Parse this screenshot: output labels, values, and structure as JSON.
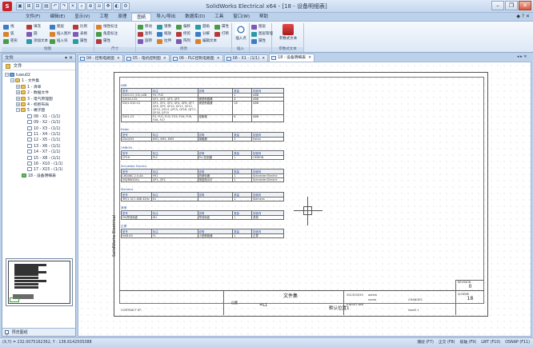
{
  "app": {
    "logo_letter": "S",
    "title": "SolidWorks Electrical x64 - [18 - 设备明细表]",
    "qat": [
      "▣",
      "⊞",
      "⊟",
      "▤",
      "↶",
      "↷",
      "✕",
      "⌕",
      "⊕",
      "⊖",
      "✥",
      "◐",
      "⚙"
    ]
  },
  "window_controls": {
    "minimize": "–",
    "maximize": "❐",
    "close": "✕"
  },
  "ribbon_tabs": [
    "文件(F)",
    "编辑(E)",
    "显示(V)",
    "工程",
    "原理",
    "图纸",
    "导入/导出",
    "数据库(D)",
    "工具",
    "窗口(W)",
    "帮助"
  ],
  "active_ribbon_tab": "图纸",
  "ribbon_right": "◆ ? ✕",
  "ribbon_groups": [
    {
      "label": "绘图",
      "items": [
        "线",
        "弧",
        "矩形",
        "填充",
        "圆",
        "添加文本",
        "图层",
        "插入图片",
        "插入块",
        "比例",
        "表格",
        "属性"
      ]
    },
    {
      "label": "尺寸",
      "items": [
        "线性标注",
        "角度标注",
        "属性"
      ]
    },
    {
      "label": "修改",
      "items": [
        "移动",
        "复制",
        "旋转",
        "镜像",
        "缩放",
        "拉伸",
        "偏移",
        "修剪",
        "阵列",
        "圆角",
        "分解",
        "编辑文本",
        "属性",
        "打断"
      ]
    },
    {
      "label": "插入",
      "items": [
        "插入点",
        "编辑",
        "命令"
      ]
    },
    {
      "label": "",
      "items": [
        "图层",
        "图层管理",
        "属性"
      ]
    },
    {
      "label": "参数式文本",
      "items": [
        "参数式文本"
      ]
    }
  ],
  "left_panel": {
    "header": "文件",
    "pin": "▾ ✕",
    "tool": "文件",
    "tree": [
      {
        "label": "tuwu02",
        "level": 0,
        "type": "proj",
        "toggle": "−"
      },
      {
        "label": "1 - 文件集",
        "level": 1,
        "type": "folder",
        "toggle": "−"
      },
      {
        "label": "1 - 清单",
        "level": 2,
        "type": "folder",
        "toggle": "+"
      },
      {
        "label": "2 - 数据文件",
        "level": 2,
        "type": "folder",
        "toggle": "+"
      },
      {
        "label": "3 - 电气原理图",
        "level": 2,
        "type": "folder",
        "toggle": "+"
      },
      {
        "label": "4 - 机柜布局",
        "level": 2,
        "type": "folder",
        "toggle": "+"
      },
      {
        "label": "5 - 端子图",
        "level": 2,
        "type": "folder",
        "toggle": "−"
      },
      {
        "label": "08 - X1 - (1/1)",
        "level": 3,
        "type": "doc",
        "toggle": ""
      },
      {
        "label": "09 - X2 - (1/1)",
        "level": 3,
        "type": "doc",
        "toggle": ""
      },
      {
        "label": "10 - X3 - (1/1)",
        "level": 3,
        "type": "doc",
        "toggle": ""
      },
      {
        "label": "11 - X4 - (1/1)",
        "level": 3,
        "type": "doc",
        "toggle": ""
      },
      {
        "label": "12 - X5 - (1/1)",
        "level": 3,
        "type": "doc",
        "toggle": ""
      },
      {
        "label": "13 - X6 - (1/1)",
        "level": 3,
        "type": "doc",
        "toggle": ""
      },
      {
        "label": "14 - X7 - (1/1)",
        "level": 3,
        "type": "doc",
        "toggle": ""
      },
      {
        "label": "15 - X8 - (1/1)",
        "level": 3,
        "type": "doc",
        "toggle": ""
      },
      {
        "label": "16 - X10 - (1/1)",
        "level": 3,
        "type": "doc",
        "toggle": ""
      },
      {
        "label": "17 - X15 - (1/1)",
        "level": 3,
        "type": "doc",
        "toggle": ""
      },
      {
        "label": "18 - 设备明细表",
        "level": 2,
        "type": "list",
        "toggle": ""
      }
    ],
    "footer": "预览图纸"
  },
  "doc_tabs": [
    {
      "label": "04 - 控制电路图",
      "active": false
    },
    {
      "label": "05 - 电机控制图",
      "active": false
    },
    {
      "label": "06 - PLC控制电路图",
      "active": false
    },
    {
      "label": "08 - X1 - (1/1)",
      "active": false
    },
    {
      "label": "18 - 设备明细表",
      "active": true
    }
  ],
  "doc_tabs_ctl": "◂ ▸ ✕",
  "bom": {
    "headers": [
      "型号",
      "标注",
      "说明",
      "数量",
      "制造商"
    ],
    "sections": [
      {
        "title": "ABB",
        "rows": [
          [
            "S200-C2 (10)-x4B",
            "FU, FU2",
            "",
            "2",
            "ABB"
          ],
          [
            "S204S-C32",
            "QF1, QF2, QF3, QF5",
            "微型断路器",
            "4",
            "ABB"
          ],
          [
            "S201-K10-C2",
            "QF1, QF2, QF3, QF4, QF6, QF7, QF8, QF9, QF10, QF11, QF12, QF13, QF14, QF15, QF16, QF17, QF18, QF19",
            "微型断路器",
            "18",
            "ABB"
          ],
          [
            "S201-C2",
            "FU, FU1, FU2, FU3, FU4, FU5, FU6, FU7",
            "熔断器",
            "8",
            "ABB"
          ]
        ]
      },
      {
        "title": "Eaton",
        "rows": [
          [
            "DIL0203",
            "KM1, KM2, KM3",
            "接触器",
            "3",
            "Eaton"
          ]
        ]
      },
      {
        "title": "OMRON",
        "rows": [
          [
            "CP1H",
            "PLC",
            "PLC控制器",
            "1",
            "OMRON"
          ]
        ]
      },
      {
        "title": "Schneider Electric",
        "rows": [
          [
            "LRD08C 2.5-4A",
            "FR1",
            "热继电器",
            "1",
            "Schneider Electric"
          ],
          [
            "XB2BW3341",
            "QF1, QF2",
            "按钮指示灯",
            "2",
            "Schneider Electric"
          ]
        ]
      },
      {
        "title": "Siemens",
        "rows": [
          [
            "3RT1 017-1BB 42Hz",
            "K1",
            "",
            "1",
            "Siemens"
          ]
        ]
      },
      {
        "title": "其他",
        "rows": [
          [
            "DYJ导线电缆",
            "W1",
            "导线电缆",
            "1",
            "其他"
          ]
        ]
      },
      {
        "title": "正泰",
        "rows": [
          [
            "NXB-63",
            "F1",
            "小型断路器",
            "1",
            "正泰"
          ]
        ]
      }
    ]
  },
  "title_block": {
    "name": "文件集",
    "position_label": "位置",
    "position_value": "=L1",
    "location": "默认位置1",
    "contract_label": "CONTRACT N°:",
    "company": "SolidWorks Electrical",
    "date": "2013/03/29",
    "author": "admin",
    "approver": "name",
    "page_label": "CHANGES",
    "file_ref": "tuwu02.tew",
    "sheet_ref": "sheet 1",
    "revision_label": "REVISION",
    "revision": "0",
    "scheme_label": "SCHEME",
    "scheme": "18"
  },
  "status": {
    "coord": "(X,Y) = 232.0075162362, Y : 136.614250S388",
    "modes": [
      "捕捉 (F7)",
      "正交 (F8)",
      "极轴 (F9)",
      "LWT (F10)",
      "OSNAP (F11)"
    ]
  }
}
